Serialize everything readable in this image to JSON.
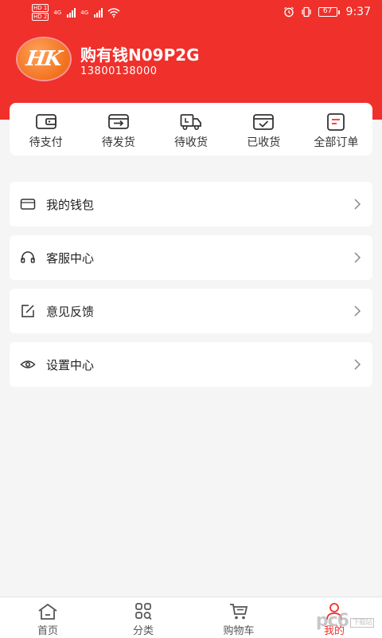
{
  "status_bar": {
    "hd1": "HD 1",
    "hd2": "HD 2",
    "net1": "4G",
    "net2": "4G",
    "battery": "67",
    "time": "9:37"
  },
  "profile": {
    "avatar_text": "HK",
    "name": "购有钱N09P2G",
    "phone": "13800138000"
  },
  "orders": [
    {
      "label": "待支付",
      "icon": "wallet-icon"
    },
    {
      "label": "待发货",
      "icon": "package-out-icon"
    },
    {
      "label": "待收货",
      "icon": "truck-icon"
    },
    {
      "label": "已收货",
      "icon": "box-check-icon"
    },
    {
      "label": "全部订单",
      "icon": "order-list-icon"
    }
  ],
  "menu": [
    {
      "label": "我的钱包",
      "icon": "card-icon"
    },
    {
      "label": "客服中心",
      "icon": "headset-icon"
    },
    {
      "label": "意见反馈",
      "icon": "edit-icon"
    },
    {
      "label": "设置中心",
      "icon": "eye-icon"
    }
  ],
  "tabs": [
    {
      "label": "首页",
      "icon": "home-icon",
      "active": false
    },
    {
      "label": "分类",
      "icon": "category-icon",
      "active": false
    },
    {
      "label": "购物车",
      "icon": "cart-icon",
      "active": false
    },
    {
      "label": "我的",
      "icon": "user-icon",
      "active": true
    }
  ],
  "watermark": {
    "main": "pc6",
    "sub": "下载站"
  },
  "colors": {
    "accent": "#f0302b",
    "background": "#f5f5f5",
    "avatar": "#f2711e"
  }
}
